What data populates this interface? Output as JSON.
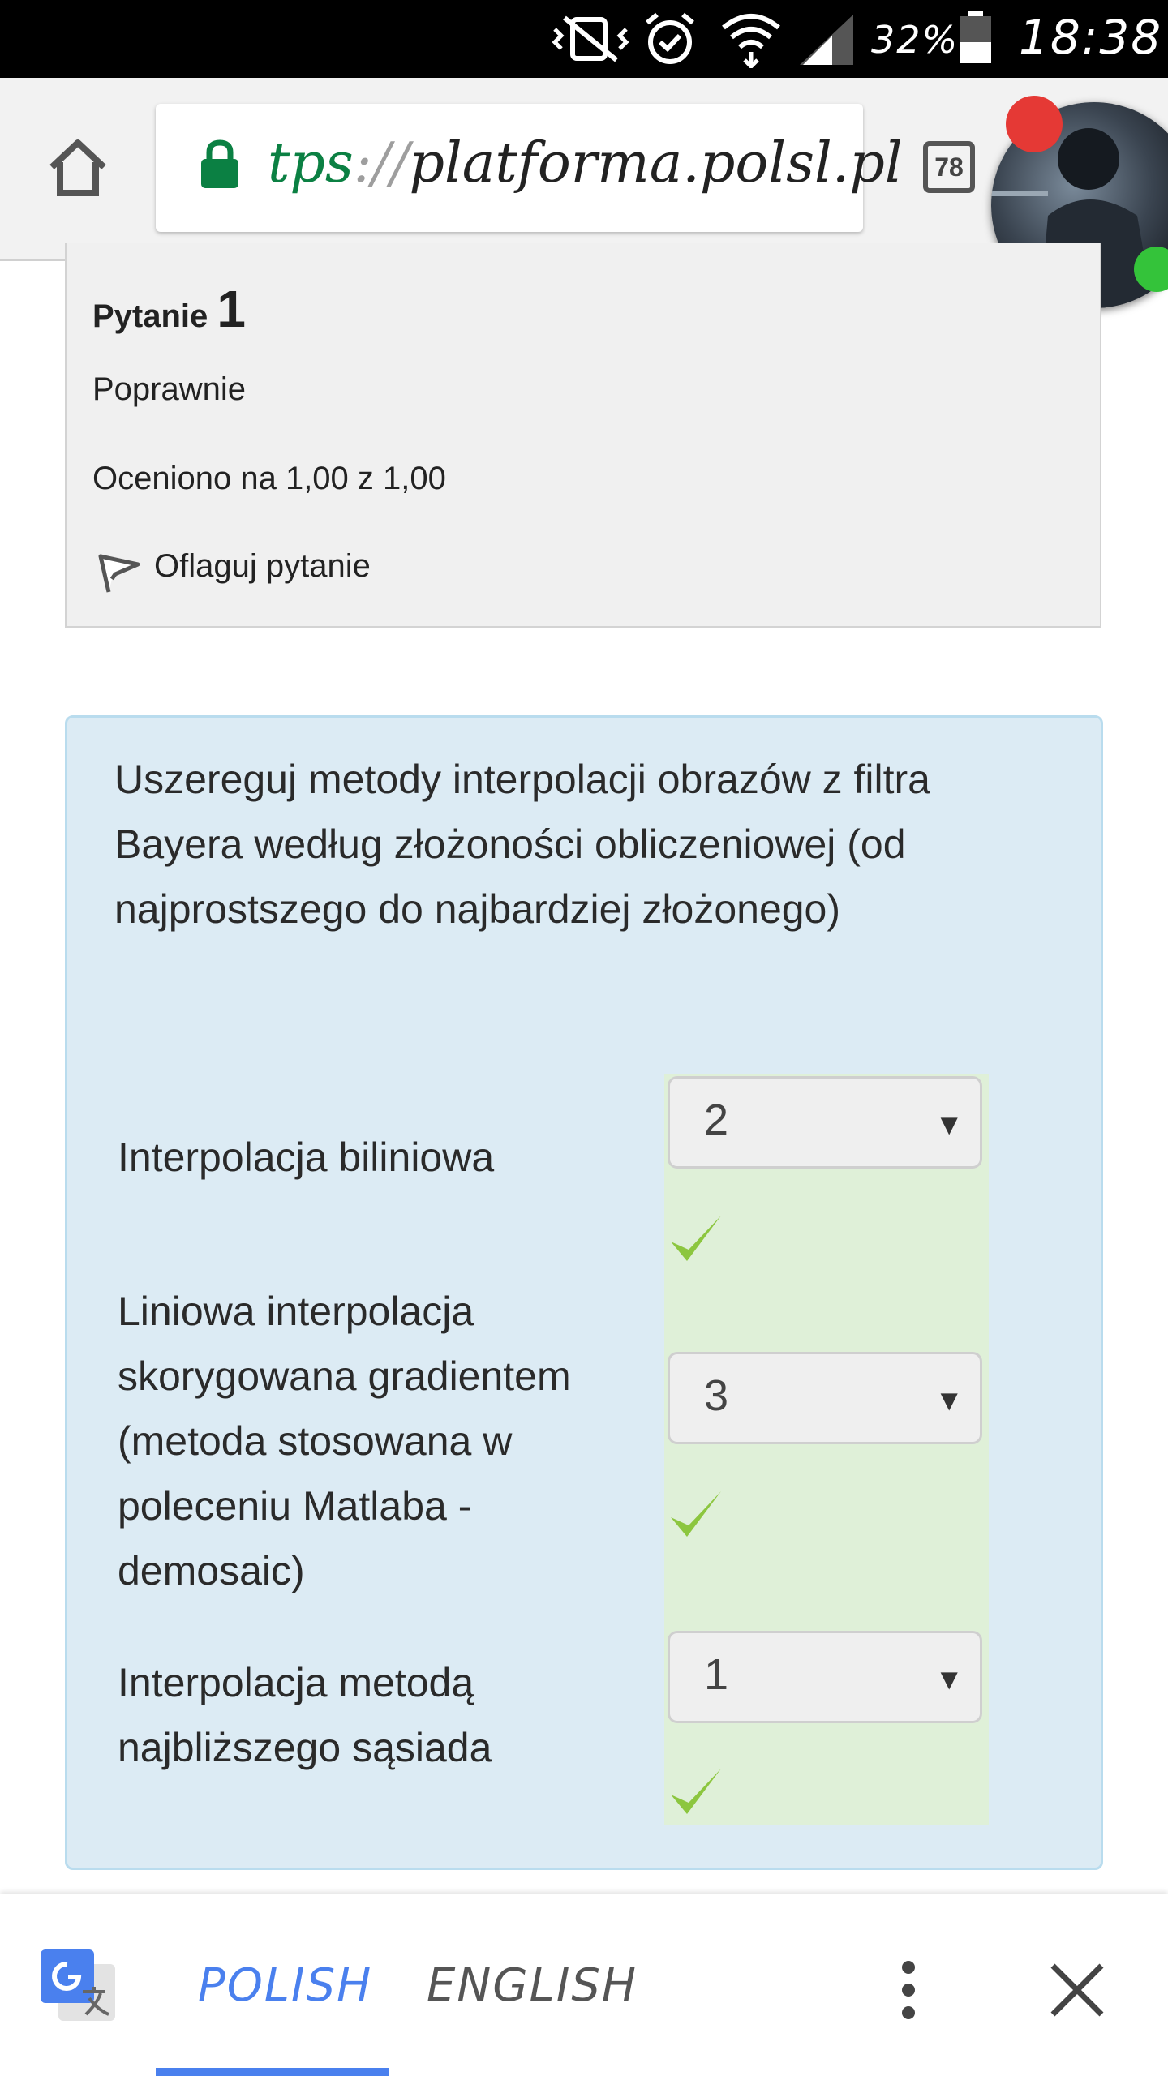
{
  "status_bar": {
    "battery": "32%",
    "time": "18:38"
  },
  "browser": {
    "url_scheme": "tps",
    "url_sep": "://",
    "url_host": "platforma.polsl.pl",
    "tab_count": "78"
  },
  "question": {
    "title_label": "Pytanie",
    "number": "1",
    "state": "Poprawnie",
    "grade": "Oceniono na 1,00 z 1,00",
    "flag_label": "Oflaguj pytanie",
    "text": "Uszereguj metody interpolacji obrazów z filtra Bayera według złożoności obliczeniowej (od najprostszego do najbardziej złożonego)",
    "items": [
      {
        "label": "Interpolacja biliniowa",
        "value": "2",
        "correct": true
      },
      {
        "label": "Liniowa interpolacja skorygowana gradientem (metoda stosowana w poleceniu Matlaba - demosaic)",
        "value": "3",
        "correct": true
      },
      {
        "label": "Interpolacja metodą najbliższego sąsiada",
        "value": "1",
        "correct": true
      }
    ]
  },
  "translate_bar": {
    "tab_polish": "POLISH",
    "tab_english": "ENGLISH",
    "active_tab": "POLISH",
    "accent_color": "#4a80ee"
  },
  "colors": {
    "correct_bg": "#dff0d8",
    "question_bg": "#dcebf4",
    "check": "#8cc63f",
    "secure_lock": "#0b8043"
  }
}
